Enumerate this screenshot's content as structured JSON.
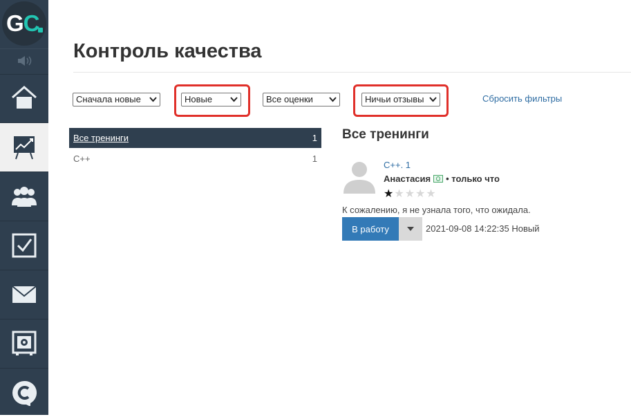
{
  "app": {
    "logo_text_g": "G",
    "logo_text_c": "C"
  },
  "sidebar": {
    "items": [
      {
        "name": "home-icon"
      },
      {
        "name": "presentation-chart-icon",
        "active": true
      },
      {
        "name": "users-group-icon"
      },
      {
        "name": "checkbox-icon"
      },
      {
        "name": "mail-icon"
      },
      {
        "name": "safe-icon"
      },
      {
        "name": "chat-c-icon"
      }
    ]
  },
  "page": {
    "title": "Контроль качества"
  },
  "filters": {
    "sort": "Сначала новые",
    "status": "Новые",
    "rating": "Все оценки",
    "owner": "Ничьи отзывы",
    "reset_label": "Сбросить фильтры"
  },
  "trainings_list": {
    "header": {
      "label": "Все тренинги",
      "count": "1"
    },
    "rows": [
      {
        "label": "C++",
        "count": "1"
      }
    ]
  },
  "main": {
    "section_title": "Все тренинги",
    "review": {
      "course": "C++. 1",
      "author": "Анастасия",
      "when": "• только что",
      "rating": 1,
      "rating_max": 5,
      "text": "К сожалению, я не узнала того, что ожидала.",
      "action_label": "В работу",
      "meta": "2021-09-08 14:22:35 Новый"
    }
  },
  "colors": {
    "sidebar": "#2f3f4f",
    "accent": "#22c5b2",
    "primary": "#337ab7",
    "highlight": "#e0302a",
    "link": "#2f6da3"
  }
}
